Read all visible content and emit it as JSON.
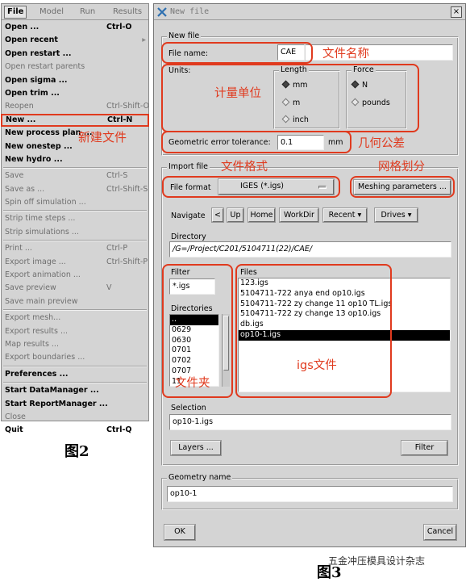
{
  "menu": {
    "menubar": [
      "File",
      "Model",
      "Run",
      "Results"
    ],
    "items": [
      {
        "label": "Open ...",
        "shortcut": "Ctrl-O",
        "enabled": true
      },
      {
        "label": "Open recent",
        "shortcut": "",
        "enabled": true,
        "submenu": true
      },
      {
        "label": "Open restart ...",
        "shortcut": "",
        "enabled": true
      },
      {
        "label": "Open restart parents",
        "shortcut": "",
        "enabled": false
      },
      {
        "label": "Open sigma ...",
        "shortcut": "",
        "enabled": true
      },
      {
        "label": "Open trim ...",
        "shortcut": "",
        "enabled": true
      },
      {
        "label": "Reopen",
        "shortcut": "Ctrl-Shift-O",
        "enabled": false
      },
      {
        "label": "New ...",
        "shortcut": "Ctrl-N",
        "enabled": true,
        "highlight": true
      },
      {
        "label": "New process plan ...",
        "shortcut": "",
        "enabled": true
      },
      {
        "label": "New onestep ...",
        "shortcut": "",
        "enabled": true
      },
      {
        "label": "New hydro ...",
        "shortcut": "",
        "enabled": true
      },
      {
        "sep": true
      },
      {
        "label": "Save",
        "shortcut": "Ctrl-S",
        "enabled": false
      },
      {
        "label": "Save as ...",
        "shortcut": "Ctrl-Shift-S",
        "enabled": false
      },
      {
        "label": "Spin off simulation ...",
        "shortcut": "",
        "enabled": false
      },
      {
        "sep": true
      },
      {
        "label": "Strip time steps ...",
        "shortcut": "",
        "enabled": false
      },
      {
        "label": "Strip simulations ...",
        "shortcut": "",
        "enabled": false
      },
      {
        "sep": true
      },
      {
        "label": "Print ...",
        "shortcut": "Ctrl-P",
        "enabled": false
      },
      {
        "label": "Export image ...",
        "shortcut": "Ctrl-Shift-P",
        "enabled": false
      },
      {
        "label": "Export animation ...",
        "shortcut": "",
        "enabled": false
      },
      {
        "label": "Save preview",
        "shortcut": "V",
        "enabled": false
      },
      {
        "label": "Save main preview",
        "shortcut": "",
        "enabled": false
      },
      {
        "sep": true
      },
      {
        "label": "Export mesh...",
        "shortcut": "",
        "enabled": false
      },
      {
        "label": "Export results ...",
        "shortcut": "",
        "enabled": false
      },
      {
        "label": "Map results ...",
        "shortcut": "",
        "enabled": false
      },
      {
        "label": "Export boundaries ...",
        "shortcut": "",
        "enabled": false
      },
      {
        "sep": true
      },
      {
        "label": "Preferences ...",
        "shortcut": "",
        "enabled": true
      },
      {
        "sep": true
      },
      {
        "label": "Start DataManager ...",
        "shortcut": "",
        "enabled": true
      },
      {
        "label": "Start ReportManager ...",
        "shortcut": "",
        "enabled": true
      },
      {
        "label": "Close",
        "shortcut": "",
        "enabled": false
      },
      {
        "label": "Quit",
        "shortcut": "Ctrl-Q",
        "enabled": true
      }
    ]
  },
  "fig2_caption": "图2",
  "fig3_caption": "图3",
  "watermark": "五金冲压模具设计杂志",
  "annotations": {
    "new_file": "新建文件",
    "file_name": "文件名称",
    "units": "计量单位",
    "tolerance": "几何公差",
    "file_format": "文件格式",
    "meshing": "网格划分",
    "igs_files": "igs文件",
    "folder": "文件夹"
  },
  "dialog": {
    "title": "New file",
    "close_glyph": "×",
    "new_file_group": "New file",
    "file_name_label": "File name:",
    "file_name_value": "CAE",
    "units_label": "Units:",
    "length_title": "Length",
    "length_options": [
      "mm",
      "m",
      "inch"
    ],
    "length_selected": "mm",
    "force_title": "Force",
    "force_options": [
      "N",
      "pounds"
    ],
    "force_selected": "N",
    "tolerance_label": "Geometric error tolerance:",
    "tolerance_value": "0.1",
    "tolerance_unit": "mm",
    "import_group": "Import file",
    "file_format_label": "File format",
    "file_format_value": "IGES  (*.igs)",
    "meshing_button": "Meshing parameters ...",
    "navigate_label": "Navigate",
    "nav_back": "<",
    "nav_up": "Up",
    "nav_home": "Home",
    "nav_workdir": "WorkDir",
    "nav_recent": "Recent",
    "nav_drives": "Drives",
    "directory_label": "Directory",
    "directory_value": "/G=/Project/C201/5104711(22)/CAE/",
    "filter_label": "Filter",
    "filter_value": "*.igs",
    "directories_label": "Directories",
    "directories": [
      "..",
      "0629",
      "0630",
      "0701",
      "0702",
      "0707",
      "11"
    ],
    "files_label": "Files",
    "files": [
      "123.igs",
      "5104711-722 anya end op10.igs",
      "5104711-722 zy change 11 op10 TL.igs",
      "5104711-722 zy change 13 op10.igs",
      "db.igs",
      "op10-1.igs"
    ],
    "selected_file": "op10-1.igs",
    "selection_label": "Selection",
    "selection_value": "op10-1.igs",
    "layers_button": "Layers ...",
    "filter_button": "Filter",
    "geometry_group": "Geometry name",
    "geometry_value": "op10-1",
    "ok_button": "OK",
    "cancel_button": "Cancel"
  }
}
